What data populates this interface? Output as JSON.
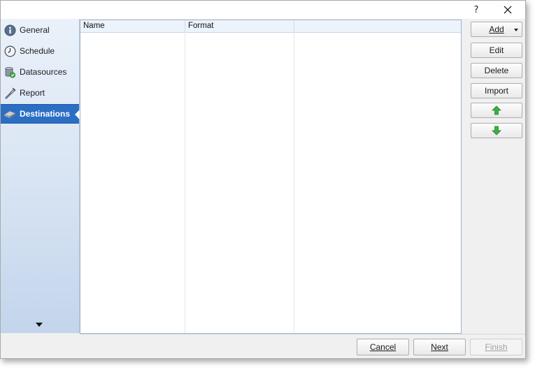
{
  "titlebar": {
    "help_label": "?",
    "close_icon": "close-icon"
  },
  "sidebar": {
    "items": [
      {
        "label": "General",
        "icon": "info-icon"
      },
      {
        "label": "Schedule",
        "icon": "clock-icon"
      },
      {
        "label": "Datasources",
        "icon": "database-icon"
      },
      {
        "label": "Report",
        "icon": "report-icon"
      },
      {
        "label": "Destinations",
        "icon": "destinations-icon",
        "active": true
      }
    ]
  },
  "list": {
    "columns": [
      "Name",
      "Format",
      ""
    ],
    "rows": []
  },
  "actions": {
    "add_label": "Add",
    "edit_label": "Edit",
    "delete_label": "Delete",
    "import_label": "Import",
    "move_up_icon": "green-up-arrow-icon",
    "move_down_icon": "green-down-arrow-icon"
  },
  "footer": {
    "cancel_label": "Cancel",
    "next_label": "Next",
    "finish_label": "Finish"
  },
  "colors": {
    "active_nav": "#2a6fc4",
    "sidebar_top": "#eaf1fa",
    "sidebar_bottom": "#c3d5ec",
    "arrow_green": "#3cb043"
  }
}
